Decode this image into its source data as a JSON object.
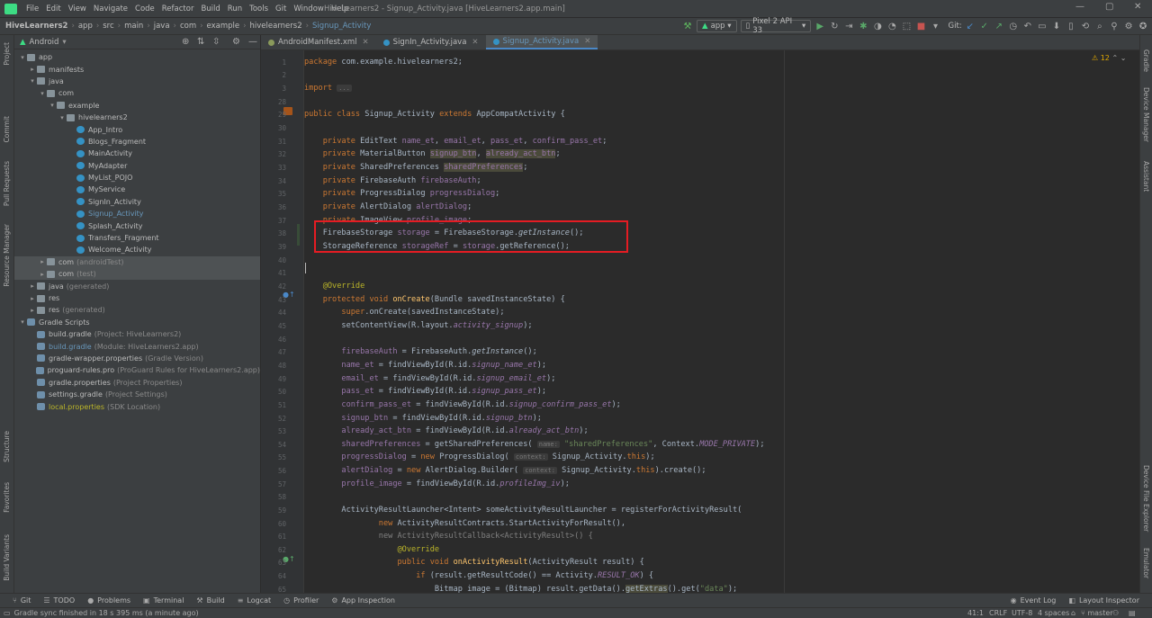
{
  "menubar": {
    "items": [
      "File",
      "Edit",
      "View",
      "Navigate",
      "Code",
      "Refactor",
      "Build",
      "Run",
      "Tools",
      "Git",
      "Window",
      "Help"
    ],
    "title": "HiveLearners2 - Signup_Activity.java [HiveLearners2.app.main]"
  },
  "breadcrumb": [
    "HiveLearners2",
    "app",
    "src",
    "main",
    "java",
    "com",
    "example",
    "hivelearners2",
    "Signup_Activity"
  ],
  "toolbar": {
    "run_config": "app",
    "device": "Pixel 2 API 33",
    "git_label": "Git:"
  },
  "project_panel": {
    "view_mode": "Android",
    "tree": [
      {
        "indent": 0,
        "arrow": "▾",
        "icon": "fold",
        "label": "app",
        "suffix": ""
      },
      {
        "indent": 1,
        "arrow": "▸",
        "icon": "fold",
        "label": "manifests",
        "suffix": ""
      },
      {
        "indent": 1,
        "arrow": "▾",
        "icon": "fold",
        "label": "java",
        "suffix": ""
      },
      {
        "indent": 2,
        "arrow": "▾",
        "icon": "fold",
        "label": "com",
        "suffix": ""
      },
      {
        "indent": 3,
        "arrow": "▾",
        "icon": "fold",
        "label": "example",
        "suffix": ""
      },
      {
        "indent": 4,
        "arrow": "▾",
        "icon": "fold",
        "label": "hivelearners2",
        "suffix": ""
      },
      {
        "indent": 5,
        "arrow": "",
        "icon": "cls",
        "label": "App_Intro",
        "suffix": ""
      },
      {
        "indent": 5,
        "arrow": "",
        "icon": "cls",
        "label": "Blogs_Fragment",
        "suffix": ""
      },
      {
        "indent": 5,
        "arrow": "",
        "icon": "cls",
        "label": "MainActivity",
        "suffix": ""
      },
      {
        "indent": 5,
        "arrow": "",
        "icon": "cls",
        "label": "MyAdapter",
        "suffix": ""
      },
      {
        "indent": 5,
        "arrow": "",
        "icon": "cls",
        "label": "MyList_POJO",
        "suffix": ""
      },
      {
        "indent": 5,
        "arrow": "",
        "icon": "cls",
        "label": "MyService",
        "suffix": ""
      },
      {
        "indent": 5,
        "arrow": "",
        "icon": "cls",
        "label": "SignIn_Activity",
        "suffix": ""
      },
      {
        "indent": 5,
        "arrow": "",
        "icon": "cls",
        "label": "Signup_Activity",
        "suffix": "",
        "selected": true
      },
      {
        "indent": 5,
        "arrow": "",
        "icon": "cls",
        "label": "Splash_Activity",
        "suffix": ""
      },
      {
        "indent": 5,
        "arrow": "",
        "icon": "cls",
        "label": "Transfers_Fragment",
        "suffix": ""
      },
      {
        "indent": 5,
        "arrow": "",
        "icon": "cls",
        "label": "Welcome_Activity",
        "suffix": ""
      },
      {
        "indent": 2,
        "arrow": "▸",
        "icon": "fold",
        "label": "com",
        "suffix": "(androidTest)",
        "hl": true
      },
      {
        "indent": 2,
        "arrow": "▸",
        "icon": "fold",
        "label": "com",
        "suffix": "(test)",
        "hl": true
      },
      {
        "indent": 1,
        "arrow": "▸",
        "icon": "fold",
        "label": "java",
        "suffix": "(generated)"
      },
      {
        "indent": 1,
        "arrow": "▸",
        "icon": "fold",
        "label": "res",
        "suffix": ""
      },
      {
        "indent": 1,
        "arrow": "▸",
        "icon": "fold",
        "label": "res",
        "suffix": "(generated)"
      },
      {
        "indent": 0,
        "arrow": "▾",
        "icon": "grd",
        "label": "Gradle Scripts",
        "suffix": ""
      },
      {
        "indent": 1,
        "arrow": "",
        "icon": "grd",
        "label": "build.gradle",
        "suffix": "(Project: HiveLearners2)"
      },
      {
        "indent": 1,
        "arrow": "",
        "icon": "grd",
        "label": "build.gradle",
        "suffix": "(Module: HiveLearners2.app)",
        "blue": true
      },
      {
        "indent": 1,
        "arrow": "",
        "icon": "grd",
        "label": "gradle-wrapper.properties",
        "suffix": "(Gradle Version)"
      },
      {
        "indent": 1,
        "arrow": "",
        "icon": "grd",
        "label": "proguard-rules.pro",
        "suffix": "(ProGuard Rules for HiveLearners2.app)"
      },
      {
        "indent": 1,
        "arrow": "",
        "icon": "grd",
        "label": "gradle.properties",
        "suffix": "(Project Properties)"
      },
      {
        "indent": 1,
        "arrow": "",
        "icon": "grd",
        "label": "settings.gradle",
        "suffix": "(Project Settings)"
      },
      {
        "indent": 1,
        "arrow": "",
        "icon": "grd",
        "label": "local.properties",
        "suffix": "(SDK Location)",
        "yellow": true
      }
    ]
  },
  "left_stripe": [
    "Project",
    "Commit",
    "Pull Requests",
    "Resource Manager",
    "Structure",
    "Favorites",
    "Build Variants"
  ],
  "right_stripe": [
    "Gradle",
    "Device Manager",
    "Assistant",
    "Device File Explorer",
    "Emulator"
  ],
  "editor": {
    "tabs": [
      {
        "label": "AndroidManifest.xml",
        "active": false
      },
      {
        "label": "SignIn_Activity.java",
        "active": false
      },
      {
        "label": "Signup_Activity.java",
        "active": true
      }
    ],
    "warnings": "⚠ 12",
    "lines": [
      {
        "n": "1",
        "html": "<span class='kw'>package</span> com.example.hivelearners2;"
      },
      {
        "n": "2",
        "html": ""
      },
      {
        "n": "3",
        "html": "<span class='kw'>import</span> <span class='hint'>...</span>"
      },
      {
        "n": "28",
        "html": ""
      },
      {
        "n": "29",
        "html": "<span class='kw'>public class</span> Signup_Activity <span class='kw'>extends</span> AppCompatActivity {"
      },
      {
        "n": "30",
        "html": ""
      },
      {
        "n": "31",
        "html": "    <span class='kw'>private</span> EditText <span class='fld'>name_et</span>, <span class='fld'>email_et</span>, <span class='fld'>pass_et</span>, <span class='fld'>confirm_pass_et</span>;"
      },
      {
        "n": "32",
        "html": "    <span class='kw'>private</span> MaterialButton <span class='fld unused'>signup_btn</span>, <span class='fld unused'>already_act_btn</span>;"
      },
      {
        "n": "33",
        "html": "    <span class='kw'>private</span> SharedPreferences <span class='fld unused'>sharedPreferences</span>;"
      },
      {
        "n": "34",
        "html": "    <span class='kw'>private</span> FirebaseAuth <span class='fld'>firebaseAuth</span>;"
      },
      {
        "n": "35",
        "html": "    <span class='kw'>private</span> ProgressDialog <span class='fld'>progressDialog</span>;"
      },
      {
        "n": "36",
        "html": "    <span class='kw'>private</span> AlertDialog <span class='fld'>alertDialog</span>;"
      },
      {
        "n": "37",
        "html": "    <span class='kw'>private</span> ImageView <span class='fld'>profile_image</span>;"
      },
      {
        "n": "38",
        "html": "    FirebaseStorage <span class='fld'>storage</span> = FirebaseStorage.<span class='itl'>getInstance</span>();"
      },
      {
        "n": "39",
        "html": "    StorageReference <span class='fld'>storageRef</span> = <span class='fld'>storage</span>.getReference();"
      },
      {
        "n": "40",
        "html": ""
      },
      {
        "n": "41",
        "html": ""
      },
      {
        "n": "42",
        "html": "    <span class='an'>@Override</span>"
      },
      {
        "n": "43",
        "html": "    <span class='kw'>protected void</span> <span class='mth'>onCreate</span>(Bundle savedInstanceState) {"
      },
      {
        "n": "44",
        "html": "        <span class='kw'>super</span>.onCreate(savedInstanceState);"
      },
      {
        "n": "45",
        "html": "        setContentView(R.layout.<span class='fld itl'>activity_signup</span>);"
      },
      {
        "n": "46",
        "html": ""
      },
      {
        "n": "47",
        "html": "        <span class='fld'>firebaseAuth</span> = FirebaseAuth.<span class='itl'>getInstance</span>();"
      },
      {
        "n": "48",
        "html": "        <span class='fld'>name_et</span> = findViewById(R.id.<span class='fld itl'>signup_name_et</span>);"
      },
      {
        "n": "49",
        "html": "        <span class='fld'>email_et</span> = findViewById(R.id.<span class='fld itl'>signup_email_et</span>);"
      },
      {
        "n": "50",
        "html": "        <span class='fld'>pass_et</span> = findViewById(R.id.<span class='fld itl'>signup_pass_et</span>);"
      },
      {
        "n": "51",
        "html": "        <span class='fld'>confirm_pass_et</span> = findViewById(R.id.<span class='fld itl'>signup_confirm_pass_et</span>);"
      },
      {
        "n": "52",
        "html": "        <span class='fld'>signup_btn</span> = findViewById(R.id.<span class='fld itl'>signup_btn</span>);"
      },
      {
        "n": "53",
        "html": "        <span class='fld'>already_act_btn</span> = findViewById(R.id.<span class='fld itl'>already_act_btn</span>);"
      },
      {
        "n": "54",
        "html": "        <span class='fld'>sharedPreferences</span> = getSharedPreferences( <span class='hint'>name:</span> <span class='str'>\"sharedPreferences\"</span>, Context.<span class='fld itl'>MODE_PRIVATE</span>);"
      },
      {
        "n": "55",
        "html": "        <span class='fld'>progressDialog</span> = <span class='kw'>new</span> ProgressDialog( <span class='hint'>context:</span> Signup_Activity.<span class='kw'>this</span>);"
      },
      {
        "n": "56",
        "html": "        <span class='fld'>alertDialog</span> = <span class='kw'>new</span> AlertDialog.Builder( <span class='hint'>context:</span> Signup_Activity.<span class='kw'>this</span>).create();"
      },
      {
        "n": "57",
        "html": "        <span class='fld'>profile_image</span> = findViewById(R.id.<span class='fld itl'>profileImg_iv</span>);"
      },
      {
        "n": "58",
        "html": ""
      },
      {
        "n": "59",
        "html": "        ActivityResultLauncher&lt;Intent&gt; someActivityResultLauncher = registerForActivityResult("
      },
      {
        "n": "60",
        "html": "                <span class='kw'>new</span> ActivityResultContracts.StartActivityForResult(),"
      },
      {
        "n": "61",
        "html": "                <span style='color:#808080'>new ActivityResultCallback&lt;ActivityResult&gt;() {</span>"
      },
      {
        "n": "62",
        "html": "                    <span class='an'>@Override</span>"
      },
      {
        "n": "63",
        "html": "                    <span class='kw'>public void</span> <span class='mth'>onActivityResult</span>(ActivityResult result) {"
      },
      {
        "n": "64",
        "html": "                        <span class='kw'>if</span> (result.getResultCode() == Activity.<span class='fld itl'>RESULT_OK</span>) {"
      },
      {
        "n": "65",
        "html": "                            Bitmap image = (Bitmap) result.getData().<span class='unused'>getExtras</span>().get(<span class='str'>\"data\"</span>);"
      }
    ]
  },
  "tool_windows": [
    {
      "icon": "⑂",
      "label": "Git"
    },
    {
      "icon": "☰",
      "label": "TODO"
    },
    {
      "icon": "●",
      "label": "Problems"
    },
    {
      "icon": "▣",
      "label": "Terminal"
    },
    {
      "icon": "⚒",
      "label": "Build"
    },
    {
      "icon": "≡",
      "label": "Logcat"
    },
    {
      "icon": "◷",
      "label": "Profiler"
    },
    {
      "icon": "⚙",
      "label": "App Inspection"
    }
  ],
  "tool_windows_right": [
    {
      "icon": "◉",
      "label": "Event Log"
    },
    {
      "icon": "◧",
      "label": "Layout Inspector"
    }
  ],
  "status": {
    "message": "Gradle sync finished in 18 s 395 ms (a minute ago)",
    "position": "41:1",
    "line_sep": "CRLF",
    "encoding": "UTF-8",
    "indent": "4 spaces",
    "branch": "master"
  }
}
